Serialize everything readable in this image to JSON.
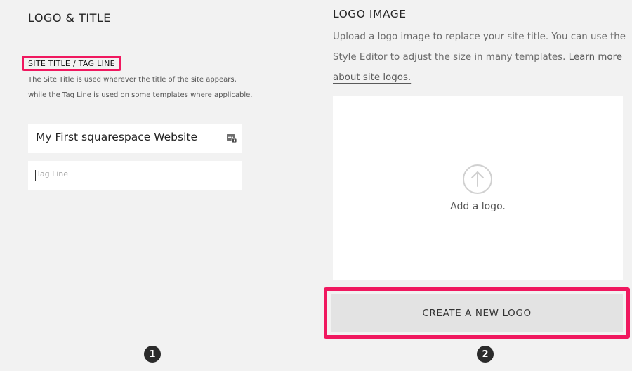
{
  "logo_title": {
    "heading": "LOGO & TITLE",
    "field_label": "SITE TITLE / TAG LINE",
    "description": "The Site Title is used wherever the title of the site appears, while the Tag Line is used on some templates where applicable.",
    "site_title_value": "My First squarespace Website",
    "tag_line_placeholder": "Tag Line"
  },
  "logo_image": {
    "heading": "LOGO IMAGE",
    "description": "Upload a logo image to replace your site title. You can use the Style Editor to adjust the size in many templates.",
    "link_text": "Learn more about site logos.",
    "upload_label": "Add a logo.",
    "create_button_label": "CREATE A NEW LOGO"
  },
  "steps": {
    "step1": "1",
    "step2": "2"
  },
  "icons": {
    "field_icon": "text-options-icon",
    "upload_icon": "upload-arrow-icon"
  },
  "colors": {
    "highlight": "#f0185f",
    "background": "#f2f2f2",
    "button_bg": "#e3e3e3",
    "badge_bg": "#2b2b2b"
  }
}
